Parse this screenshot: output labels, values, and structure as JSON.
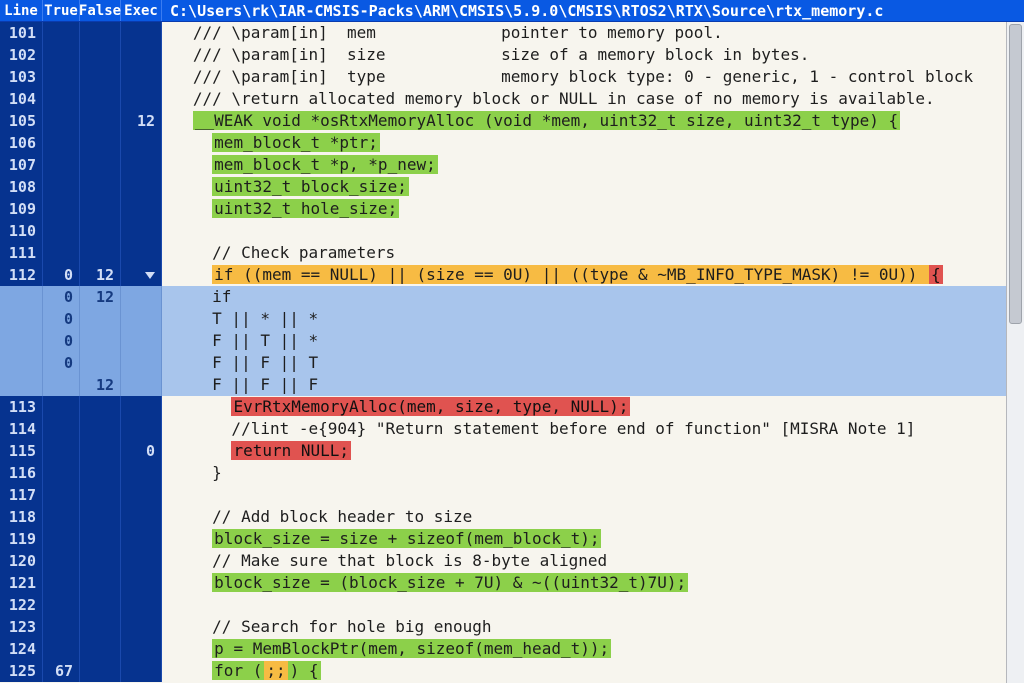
{
  "headers": {
    "line": "Line",
    "trueCol": "True",
    "falseCol": "False",
    "exec": "Exec"
  },
  "file_path": "C:\\Users\\rk\\IAR-CMSIS-Packs\\ARM\\CMSIS\\5.9.0\\CMSIS\\RTOS2\\RTX\\Source\\rtx_memory.c",
  "lines": [
    {
      "n": "101",
      "code": "   /// \\param[in]  mem             pointer to memory pool."
    },
    {
      "n": "102",
      "code": "   /// \\param[in]  size            size of a memory block in bytes."
    },
    {
      "n": "103",
      "code": "   /// \\param[in]  type            memory block type: 0 - generic, 1 - control block"
    },
    {
      "n": "104",
      "code": "   /// \\return allocated memory block or NULL in case of no memory is available."
    },
    {
      "n": "105",
      "exec": "12",
      "segs": [
        {
          "t": "   "
        },
        {
          "t": "__WEAK void *osRtxMemoryAlloc (void *mem, uint32_t size, uint32_t type) {",
          "c": "hl-green"
        }
      ]
    },
    {
      "n": "106",
      "segs": [
        {
          "t": "     "
        },
        {
          "t": "mem_block_t *ptr;",
          "c": "hl-green"
        }
      ]
    },
    {
      "n": "107",
      "segs": [
        {
          "t": "     "
        },
        {
          "t": "mem_block_t *p, *p_new;",
          "c": "hl-green"
        }
      ]
    },
    {
      "n": "108",
      "segs": [
        {
          "t": "     "
        },
        {
          "t": "uint32_t block_size;",
          "c": "hl-green"
        }
      ]
    },
    {
      "n": "109",
      "segs": [
        {
          "t": "     "
        },
        {
          "t": "uint32_t hole_size;",
          "c": "hl-green"
        }
      ]
    },
    {
      "n": "110",
      "code": ""
    },
    {
      "n": "111",
      "code": "     // Check parameters"
    },
    {
      "n": "112",
      "t": "0",
      "f": "12",
      "tri": true,
      "segs": [
        {
          "t": "     "
        },
        {
          "t": "if ((mem == NULL) || (size == 0U) || ((type & ~MB_INFO_TYPE_MASK) != 0U)) ",
          "c": "hl-orange"
        },
        {
          "t": "{",
          "c": "hl-red"
        }
      ]
    },
    {
      "mcdc": true,
      "t": "0",
      "f": "12",
      "code": "     if"
    },
    {
      "mcdc": true,
      "t": "0",
      "code": "     T || * || *"
    },
    {
      "mcdc": true,
      "t": "0",
      "code": "     F || T || *"
    },
    {
      "mcdc": true,
      "t": "0",
      "code": "     F || F || T"
    },
    {
      "mcdc": true,
      "f": "12",
      "code": "     F || F || F"
    },
    {
      "n": "113",
      "segs": [
        {
          "t": "       "
        },
        {
          "t": "EvrRtxMemoryAlloc(mem, size, type, NULL);",
          "c": "hl-red"
        }
      ]
    },
    {
      "n": "114",
      "code": "       //lint -e{904} \"Return statement before end of function\" [MISRA Note 1]"
    },
    {
      "n": "115",
      "exec": "0",
      "segs": [
        {
          "t": "       "
        },
        {
          "t": "return NULL;",
          "c": "hl-red"
        }
      ]
    },
    {
      "n": "116",
      "code": "     }"
    },
    {
      "n": "117",
      "code": ""
    },
    {
      "n": "118",
      "code": "     // Add block header to size"
    },
    {
      "n": "119",
      "segs": [
        {
          "t": "     "
        },
        {
          "t": "block_size = size + sizeof(mem_block_t);",
          "c": "hl-green"
        }
      ]
    },
    {
      "n": "120",
      "code": "     // Make sure that block is 8-byte aligned"
    },
    {
      "n": "121",
      "segs": [
        {
          "t": "     "
        },
        {
          "t": "block_size = (block_size + 7U) & ~((uint32_t)7U);",
          "c": "hl-green"
        }
      ]
    },
    {
      "n": "122",
      "code": ""
    },
    {
      "n": "123",
      "code": "     // Search for hole big enough"
    },
    {
      "n": "124",
      "segs": [
        {
          "t": "     "
        },
        {
          "t": "p = MemBlockPtr(mem, sizeof(mem_head_t));",
          "c": "hl-green"
        }
      ]
    },
    {
      "n": "125",
      "t": "67",
      "segs": [
        {
          "t": "     "
        },
        {
          "t": "for (",
          "c": "hl-green"
        },
        {
          "t": ";;",
          "c": "hl-orange"
        },
        {
          "t": ") {",
          "c": "hl-green"
        }
      ]
    }
  ]
}
